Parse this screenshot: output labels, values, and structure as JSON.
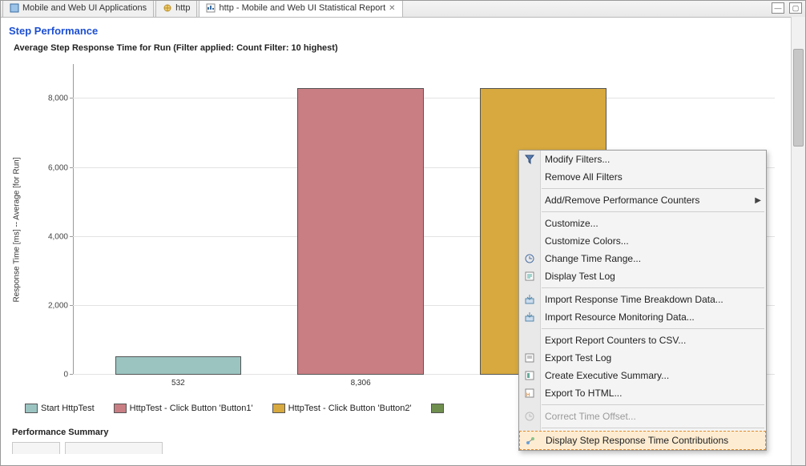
{
  "tabs": [
    {
      "label": "Mobile and Web UI Applications"
    },
    {
      "label": "http"
    },
    {
      "label": "http - Mobile and Web UI Statistical Report"
    }
  ],
  "section_title": "Step Performance",
  "chart_title": "Average Step Response Time for Run (Filter applied: Count Filter: 10 highest)",
  "yaxis": "Response Time [ms] -- Average [for Run]",
  "ticks": {
    "t0": "0",
    "t2000": "2,000",
    "t4000": "4,000",
    "t6000": "6,000",
    "t8000": "8,000"
  },
  "bar_values": {
    "b1": "532",
    "b2": "8,306",
    "b3": "8,295"
  },
  "legend": {
    "l1": "Start HttpTest",
    "l2": "HttpTest - Click Button 'Button1'",
    "l3": "HttpTest - Click Button 'Button2'"
  },
  "perf_summary": "Performance Summary",
  "menu": {
    "modify_filters": "Modify Filters...",
    "remove_filters": "Remove All Filters",
    "add_remove_counters": "Add/Remove Performance Counters",
    "customize": "Customize...",
    "customize_colors": "Customize Colors...",
    "change_time_range": "Change Time Range...",
    "display_test_log": "Display Test Log",
    "import_breakdown": "Import Response Time Breakdown Data...",
    "import_resource": "Import Resource Monitoring Data...",
    "export_csv": "Export Report Counters to CSV...",
    "export_test_log": "Export Test Log",
    "create_exec_summary": "Create Executive Summary...",
    "export_html": "Export To HTML...",
    "correct_time_offset": "Correct Time Offset...",
    "display_contrib": "Display Step Response Time Contributions"
  },
  "colors": {
    "bar1": "#9bc4c1",
    "bar2": "#c97e84",
    "bar3": "#d7a93e",
    "bar4": "#6f8f4e"
  },
  "chart_data": {
    "type": "bar",
    "title": "Average Step Response Time for Run (Filter applied: Count Filter: 10 highest)",
    "ylabel": "Response Time [ms] -- Average [for Run]",
    "xlabel": "",
    "ylim": [
      0,
      9000
    ],
    "categories": [
      "Start HttpTest",
      "HttpTest - Click Button 'Button1'",
      "HttpTest - Click Button 'Button2'"
    ],
    "values": [
      532,
      8306,
      8295
    ],
    "colors": [
      "#9bc4c1",
      "#c97e84",
      "#d7a93e"
    ]
  }
}
